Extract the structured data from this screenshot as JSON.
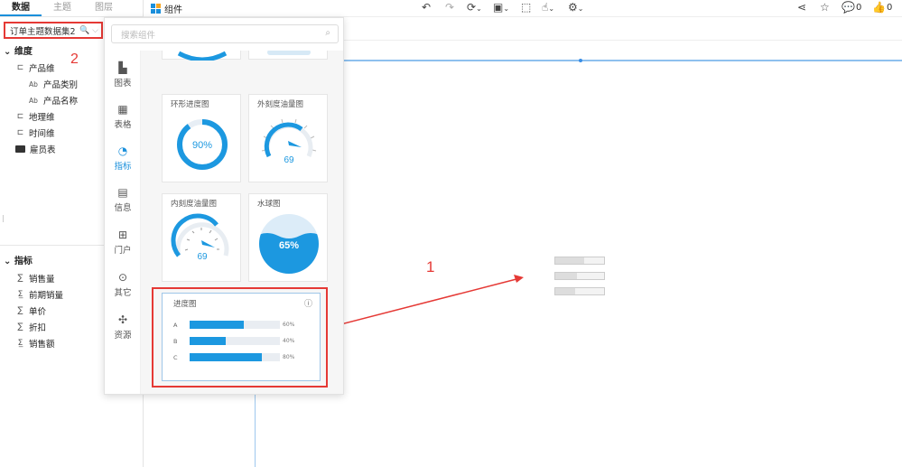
{
  "left_panel": {
    "tabs": [
      {
        "label": "数据",
        "active": true
      },
      {
        "label": "主题",
        "active": false
      },
      {
        "label": "图层",
        "active": false
      }
    ],
    "dataset": {
      "value": "订单主题数据集2",
      "icons": "🔍 ⌵"
    },
    "dimension_header": "维度",
    "dimensions": [
      {
        "label": "产品维",
        "icon": "hierarchy-icon"
      },
      {
        "label": "产品类别",
        "icon": "text-field-icon"
      },
      {
        "label": "产品名称",
        "icon": "text-field-icon"
      },
      {
        "label": "地理维",
        "icon": "hierarchy-icon"
      },
      {
        "label": "时间维",
        "icon": "hierarchy-icon"
      },
      {
        "label": "雇员表",
        "icon": "folder-icon"
      }
    ],
    "measure_header": "指标",
    "measures": [
      {
        "label": "销售量",
        "icon": "sum-icon"
      },
      {
        "label": "前期销量",
        "icon": "calc-measure-icon"
      },
      {
        "label": "单价",
        "icon": "sum-icon"
      },
      {
        "label": "折扣",
        "icon": "sum-icon"
      },
      {
        "label": "销售额",
        "icon": "calc-measure-icon"
      }
    ],
    "annotation_2": "2"
  },
  "toolbar": {
    "component_label": "组件",
    "comment_count": "0",
    "like_count": "0"
  },
  "popover": {
    "search_placeholder": "搜索组件",
    "categories": [
      {
        "label": "图表",
        "icon": "bar-chart-icon",
        "active": false
      },
      {
        "label": "表格",
        "icon": "table-icon",
        "active": false
      },
      {
        "label": "指标",
        "icon": "gauge-icon",
        "active": true
      },
      {
        "label": "信息",
        "icon": "info-panel-icon",
        "active": false
      },
      {
        "label": "门户",
        "icon": "portal-icon",
        "active": false
      },
      {
        "label": "其它",
        "icon": "more-icon",
        "active": false
      },
      {
        "label": "资源",
        "icon": "puzzle-icon",
        "active": false
      }
    ],
    "cards": [
      {
        "title": "环形进度图",
        "value": "90%"
      },
      {
        "title": "外刻度油量图",
        "value": "69"
      },
      {
        "title": "内刻度油量图",
        "value": "69"
      },
      {
        "title": "水球图",
        "value": "65%"
      }
    ],
    "progress_card": {
      "title": "进度图",
      "rows": [
        {
          "label": "A",
          "value": 60,
          "text": "60%"
        },
        {
          "label": "B",
          "value": 40,
          "text": "40%"
        },
        {
          "label": "C",
          "value": 80,
          "text": "80%"
        }
      ]
    }
  },
  "canvas": {
    "annotation_1": "1",
    "placeholder_bars": [
      0.6,
      0.45,
      0.4
    ]
  },
  "colors": {
    "accent": "#1a8fdb",
    "annotation": "#e53935",
    "progress": "#1c98e0"
  }
}
